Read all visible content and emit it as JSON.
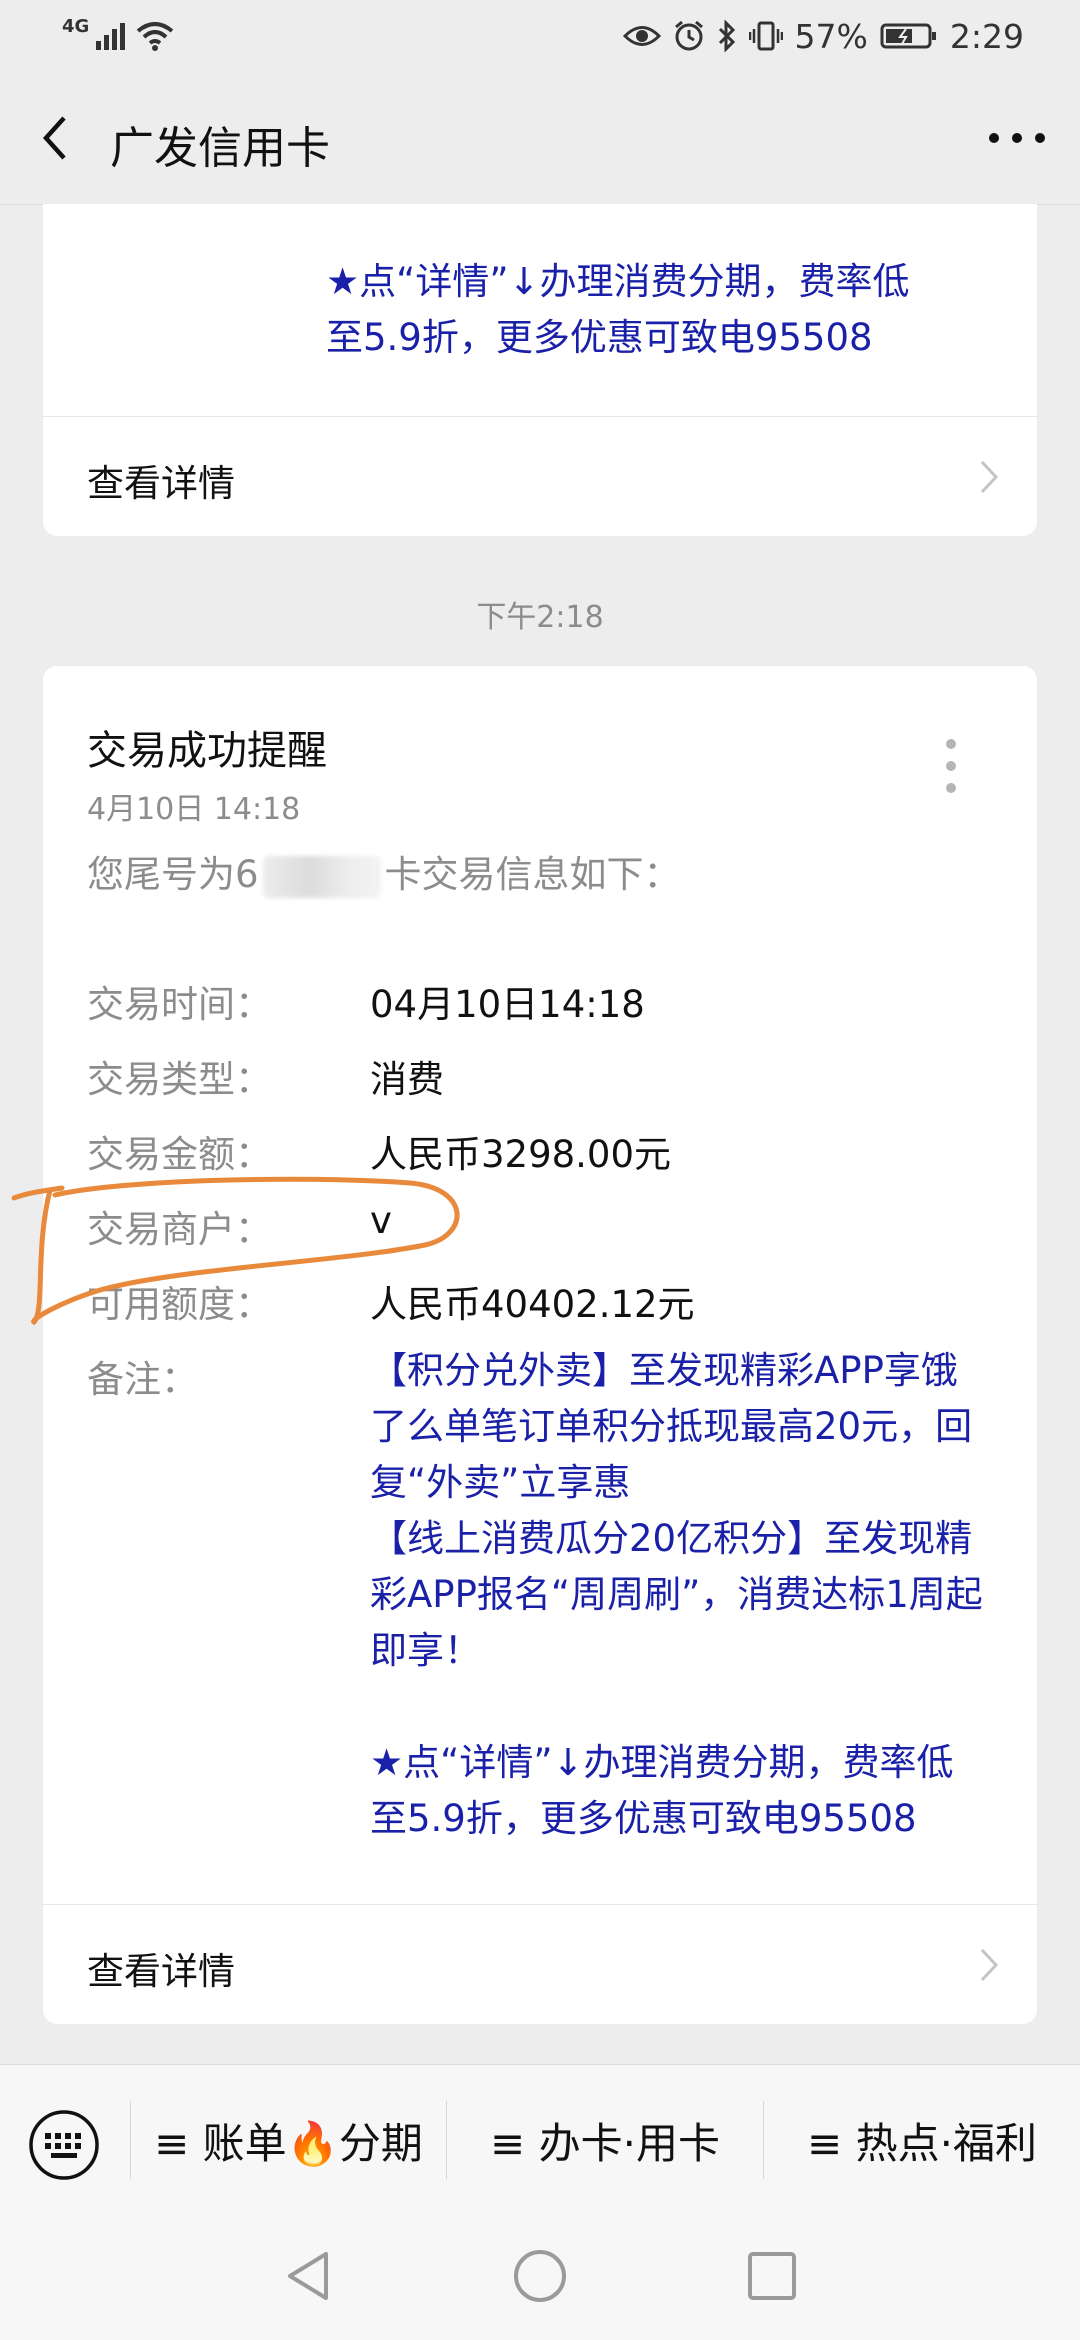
{
  "status_bar": {
    "network": "4G",
    "battery": "57%",
    "time": "2:29"
  },
  "title_bar": {
    "title": "广发信用卡"
  },
  "prev_message": {
    "promo_line1": "★点“详情”↓办理消费分期，费率低",
    "promo_line2": "至5.9折，更多优惠可致电95508",
    "detail_link": "查看详情"
  },
  "timestamp": "下午2:18",
  "message": {
    "title": "交易成功提醒",
    "date": "4月10日  14:18",
    "intro_before": "您尾号为",
    "intro_partial": "6",
    "intro_after": "卡交易信息如下：",
    "fields": [
      {
        "label": "交易时间：",
        "value": "04月10日14:18"
      },
      {
        "label": "交易类型：",
        "value": "消费"
      },
      {
        "label": "交易金额：",
        "value": "人民币3298.00元"
      },
      {
        "label": "交易商户：",
        "value": "v"
      },
      {
        "label": "可用额度：",
        "value": "人民币40402.12元"
      }
    ],
    "notes_label": "备注：",
    "notes_lines": [
      "【积分兑外卖】至发现精彩APP享饿",
      "了么单笔订单积分抵现最高20元，回",
      "复“外卖”立享惠",
      "【线上消费瓜分20亿积分】至发现精",
      "彩APP报名“周周刷”，消费达标1周起",
      "即享！",
      "",
      "★点“详情”↓办理消费分期，费率低",
      "至5.9折，更多优惠可致电95508"
    ],
    "detail_link": "查看详情"
  },
  "bottom_menu": {
    "items": [
      "≡ 账单🔥分期",
      "≡ 办卡·用卡",
      "≡ 热点·福利"
    ]
  },
  "colors": {
    "blue_text": "#1a21a8",
    "annotation": "#e8893c",
    "background": "#ededed"
  }
}
